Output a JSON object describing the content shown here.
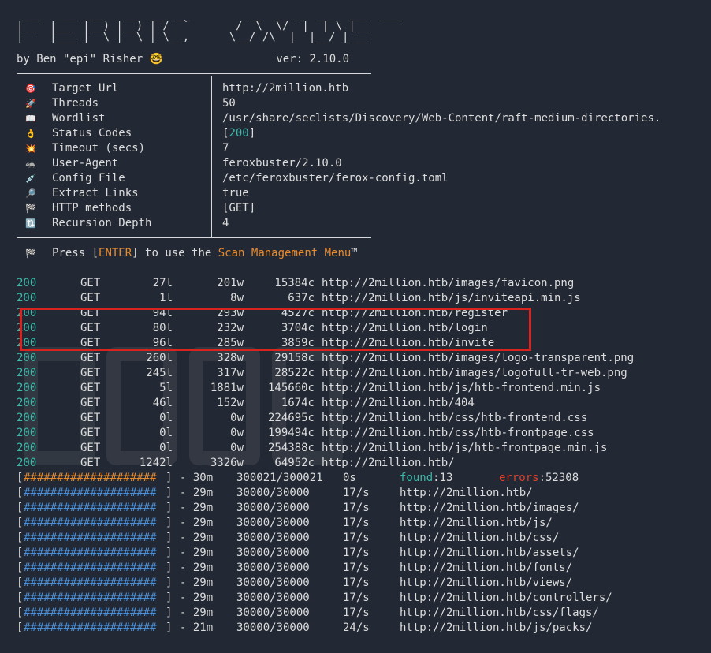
{
  "banner_art": " ___  ___  __   __  __  __         __  _  _  ___  ___  ___\n|__  |__  |__) |__) | /  `       /  \\  \\/  |  | \\ |__ \n|    |___ |  \\ |  \\ | \\__,      \\__/ /\\  |  |__/ |___",
  "byline": "by Ben \"epi\" Risher 🤓                 ver: 2.10.0",
  "config": [
    {
      "icon": "🎯",
      "icon_name": "target-icon",
      "key": "Target Url",
      "value": "http://2million.htb"
    },
    {
      "icon": "🚀",
      "icon_name": "rocket-icon",
      "key": "Threads",
      "value": "50"
    },
    {
      "icon": "📖",
      "icon_name": "book-icon",
      "key": "Wordlist",
      "value": "/usr/share/seclists/Discovery/Web-Content/raft-medium-directories."
    },
    {
      "icon": "👌",
      "icon_name": "ok-hand-icon",
      "key": "Status Codes",
      "value_prefix": "[",
      "value": "200",
      "value_suffix": "]"
    },
    {
      "icon": "💥",
      "icon_name": "collision-icon",
      "key": "Timeout (secs)",
      "value": "7"
    },
    {
      "icon": "🦡",
      "icon_name": "badger-icon",
      "key": "User-Agent",
      "value": "feroxbuster/2.10.0"
    },
    {
      "icon": "💉",
      "icon_name": "syringe-icon",
      "key": "Config File",
      "value": "/etc/feroxbuster/ferox-config.toml"
    },
    {
      "icon": "🔎",
      "icon_name": "magnifier-icon",
      "key": "Extract Links",
      "value": "true"
    },
    {
      "icon": "🏁",
      "icon_name": "flag-icon",
      "key": "HTTP methods",
      "value": "[GET]"
    },
    {
      "icon": "🔃",
      "icon_name": "recursion-icon",
      "key": "Recursion Depth",
      "value": "4"
    }
  ],
  "press": {
    "icon": "🏁",
    "before": "Press [",
    "key": "ENTER",
    "middle": "] to use the ",
    "menu": "Scan Management Menu",
    "after": "™"
  },
  "results": [
    {
      "status": "200",
      "method": "GET",
      "lines": "27l",
      "words": "201w",
      "chars": "15384c",
      "url": "http://2million.htb/images/favicon.png"
    },
    {
      "status": "200",
      "method": "GET",
      "lines": "1l",
      "words": "8w",
      "chars": "637c",
      "url": "http://2million.htb/js/inviteapi.min.js"
    },
    {
      "status": "200",
      "method": "GET",
      "lines": "94l",
      "words": "293w",
      "chars": "4527c",
      "url": "http://2million.htb/register"
    },
    {
      "status": "200",
      "method": "GET",
      "lines": "80l",
      "words": "232w",
      "chars": "3704c",
      "url": "http://2million.htb/login"
    },
    {
      "status": "200",
      "method": "GET",
      "lines": "96l",
      "words": "285w",
      "chars": "3859c",
      "url": "http://2million.htb/invite"
    },
    {
      "status": "200",
      "method": "GET",
      "lines": "260l",
      "words": "328w",
      "chars": "29158c",
      "url": "http://2million.htb/images/logo-transparent.png"
    },
    {
      "status": "200",
      "method": "GET",
      "lines": "245l",
      "words": "317w",
      "chars": "28522c",
      "url": "http://2million.htb/images/logofull-tr-web.png"
    },
    {
      "status": "200",
      "method": "GET",
      "lines": "5l",
      "words": "1881w",
      "chars": "145660c",
      "url": "http://2million.htb/js/htb-frontend.min.js"
    },
    {
      "status": "200",
      "method": "GET",
      "lines": "46l",
      "words": "152w",
      "chars": "1674c",
      "url": "http://2million.htb/404"
    },
    {
      "status": "200",
      "method": "GET",
      "lines": "0l",
      "words": "0w",
      "chars": "224695c",
      "url": "http://2million.htb/css/htb-frontend.css"
    },
    {
      "status": "200",
      "method": "GET",
      "lines": "0l",
      "words": "0w",
      "chars": "199494c",
      "url": "http://2million.htb/css/htb-frontpage.css"
    },
    {
      "status": "200",
      "method": "GET",
      "lines": "0l",
      "words": "0w",
      "chars": "254388c",
      "url": "http://2million.htb/js/htb-frontpage.min.js"
    },
    {
      "status": "200",
      "method": "GET",
      "lines": "1242l",
      "words": "3326w",
      "chars": "64952c",
      "url": "http://2million.htb/"
    }
  ],
  "overall": {
    "bar": "####################",
    "time": "- 30m",
    "count": "300021/300021",
    "rate": "0s",
    "found_label": "found",
    "found_value": ":13",
    "errors_label": "errors",
    "errors_value": ":52308"
  },
  "progress": [
    {
      "bar": "####################",
      "time": "- 29m",
      "count": "30000/30000",
      "rate": "17/s",
      "url": "http://2million.htb/"
    },
    {
      "bar": "####################",
      "time": "- 29m",
      "count": "30000/30000",
      "rate": "17/s",
      "url": "http://2million.htb/images/"
    },
    {
      "bar": "####################",
      "time": "- 29m",
      "count": "30000/30000",
      "rate": "17/s",
      "url": "http://2million.htb/js/"
    },
    {
      "bar": "####################",
      "time": "- 29m",
      "count": "30000/30000",
      "rate": "17/s",
      "url": "http://2million.htb/css/"
    },
    {
      "bar": "####################",
      "time": "- 29m",
      "count": "30000/30000",
      "rate": "17/s",
      "url": "http://2million.htb/assets/"
    },
    {
      "bar": "####################",
      "time": "- 29m",
      "count": "30000/30000",
      "rate": "17/s",
      "url": "http://2million.htb/fonts/"
    },
    {
      "bar": "####################",
      "time": "- 29m",
      "count": "30000/30000",
      "rate": "17/s",
      "url": "http://2million.htb/views/"
    },
    {
      "bar": "####################",
      "time": "- 29m",
      "count": "30000/30000",
      "rate": "17/s",
      "url": "http://2million.htb/controllers/"
    },
    {
      "bar": "####################",
      "time": "- 29m",
      "count": "30000/30000",
      "rate": "17/s",
      "url": "http://2million.htb/css/flags/"
    },
    {
      "bar": "####################",
      "time": "- 21m",
      "count": "30000/30000",
      "rate": "24/s",
      "url": "http://2million.htb/js/packs/"
    }
  ],
  "colors": {
    "background": "#232934",
    "status_teal": "#3ab8a8",
    "accent_orange": "#e88a2b",
    "error_red": "#e0402b",
    "progress_blue": "#4a8fd8",
    "highlight_box": "#d8231e"
  }
}
